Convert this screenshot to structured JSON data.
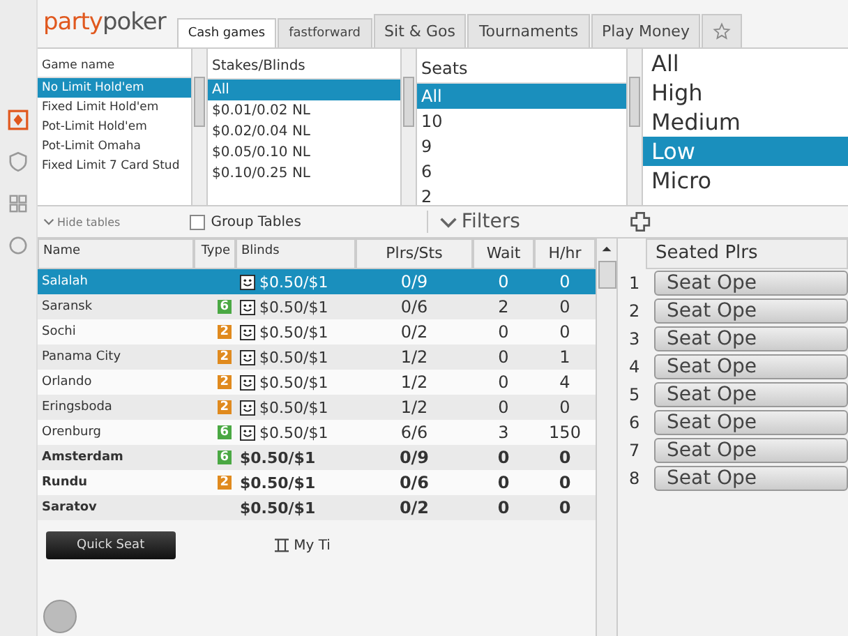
{
  "logo": {
    "text_1": "party",
    "text_2": "poker"
  },
  "tabs": [
    {
      "kind": "text",
      "label": "Cash games",
      "selected": true
    },
    {
      "kind": "text",
      "label": "fastforward",
      "selected": false
    },
    {
      "kind": "text",
      "label": "Sit & Gos",
      "selected": false
    },
    {
      "kind": "text",
      "label": "Tournaments",
      "selected": false
    },
    {
      "kind": "text",
      "label": "Play Money",
      "selected": false
    },
    {
      "kind": "star",
      "selected": false
    }
  ],
  "game_list": {
    "header": "Game name",
    "items": [
      {
        "label": "No Limit Hold'em",
        "selected": true
      },
      {
        "label": "Fixed Limit Hold'em",
        "selected": false
      },
      {
        "label": "Pot-Limit Hold'em",
        "selected": false
      },
      {
        "label": "Pot-Limit Omaha",
        "selected": false
      },
      {
        "label": "Fixed Limit 7 Card Stud",
        "selected": false
      }
    ]
  },
  "stakes_list": {
    "header": "Stakes/Blinds",
    "items": [
      {
        "label": "All",
        "selected": true
      },
      {
        "label": "$0.01/0.02 NL",
        "selected": false
      },
      {
        "label": "$0.02/0.04 NL",
        "selected": false
      },
      {
        "label": "$0.05/0.10 NL",
        "selected": false
      },
      {
        "label": "$0.10/0.25 NL",
        "selected": false
      }
    ]
  },
  "seats_list": {
    "header": "Seats",
    "items": [
      {
        "label": "All",
        "selected": true
      },
      {
        "label": "10",
        "selected": false
      },
      {
        "label": "9",
        "selected": false
      },
      {
        "label": "6",
        "selected": false
      },
      {
        "label": "2",
        "selected": false
      }
    ]
  },
  "level_list": {
    "items": [
      {
        "label": "All",
        "selected": false
      },
      {
        "label": "High",
        "selected": false
      },
      {
        "label": "Medium",
        "selected": false
      },
      {
        "label": "Low",
        "selected": true
      },
      {
        "label": "Micro",
        "selected": false
      }
    ]
  },
  "hide_tables": "Hide tables",
  "group_tables": {
    "label": "Group Tables",
    "checked": false
  },
  "filters_button": "Filters",
  "table": {
    "columns": [
      "Name",
      "Type",
      "Blinds",
      "Plrs/Sts",
      "Wait",
      "H/hr"
    ],
    "rows": [
      {
        "name": "Salalah",
        "smiley": true,
        "blinds": "$0.50/$1",
        "players": "0/9",
        "wait": "0",
        "hands": "0",
        "selected": true,
        "bold": false
      },
      {
        "name": "Saransk",
        "type": {
          "label": "6",
          "color": "#4aa843"
        },
        "smiley": true,
        "blinds": "$0.50/$1",
        "players": "0/6",
        "wait": "2",
        "hands": "0",
        "selected": false,
        "bold": false
      },
      {
        "name": "Sochi",
        "type": {
          "label": "2",
          "color": "#e08a1e"
        },
        "smiley": true,
        "blinds": "$0.50/$1",
        "players": "0/2",
        "wait": "0",
        "hands": "0",
        "selected": false,
        "bold": false
      },
      {
        "name": "Panama City",
        "type": {
          "label": "2",
          "color": "#e08a1e"
        },
        "smiley": true,
        "blinds": "$0.50/$1",
        "players": "1/2",
        "wait": "0",
        "hands": "1",
        "selected": false,
        "bold": false
      },
      {
        "name": "Orlando",
        "type": {
          "label": "2",
          "color": "#e08a1e"
        },
        "smiley": true,
        "blinds": "$0.50/$1",
        "players": "1/2",
        "wait": "0",
        "hands": "4",
        "selected": false,
        "bold": false
      },
      {
        "name": "Eringsboda",
        "type": {
          "label": "2",
          "color": "#e08a1e"
        },
        "smiley": true,
        "blinds": "$0.50/$1",
        "players": "1/2",
        "wait": "0",
        "hands": "0",
        "selected": false,
        "bold": false
      },
      {
        "name": "Orenburg",
        "type": {
          "label": "6",
          "color": "#4aa843"
        },
        "smiley": true,
        "blinds": "$0.50/$1",
        "players": "6/6",
        "wait": "3",
        "hands": "150",
        "selected": false,
        "bold": false
      },
      {
        "name": "Amsterdam",
        "type": {
          "label": "6",
          "color": "#4aa843"
        },
        "smiley": false,
        "blinds": "$0.50/$1",
        "players": "0/9",
        "wait": "0",
        "hands": "0",
        "selected": false,
        "bold": true
      },
      {
        "name": "Rundu",
        "type": {
          "label": "2",
          "color": "#e08a1e"
        },
        "smiley": false,
        "blinds": "$0.50/$1",
        "players": "0/6",
        "wait": "0",
        "hands": "0",
        "selected": false,
        "bold": true
      },
      {
        "name": "Saratov",
        "smiley": false,
        "blinds": "$0.50/$1",
        "players": "0/2",
        "wait": "0",
        "hands": "0",
        "selected": false,
        "bold": true
      }
    ]
  },
  "seat_panel": {
    "header": "Seated Plrs",
    "seats": [
      {
        "number": "1",
        "label": "Seat Ope"
      },
      {
        "number": "2",
        "label": "Seat Ope"
      },
      {
        "number": "3",
        "label": "Seat Ope"
      },
      {
        "number": "4",
        "label": "Seat Ope"
      },
      {
        "number": "5",
        "label": "Seat Ope"
      },
      {
        "number": "6",
        "label": "Seat Ope"
      },
      {
        "number": "7",
        "label": "Seat Ope"
      },
      {
        "number": "8",
        "label": "Seat Ope"
      }
    ]
  },
  "quick_seat": "Quick Seat",
  "my_tickets": "My Ti"
}
